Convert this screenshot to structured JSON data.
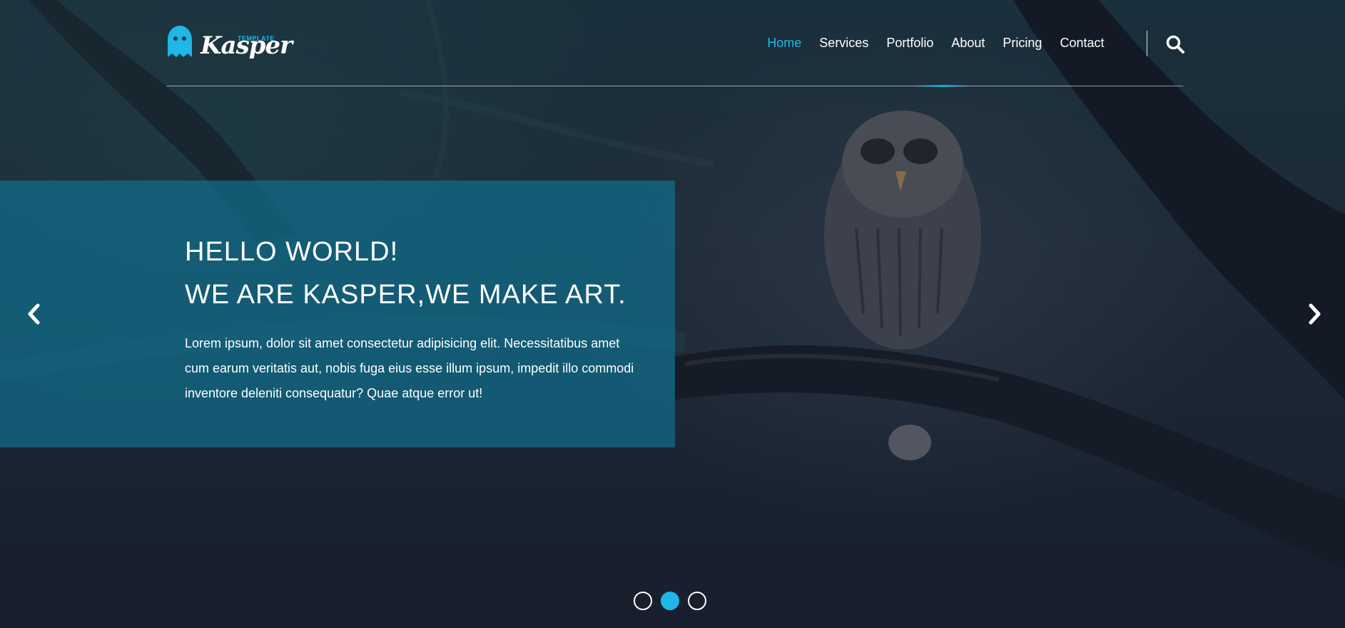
{
  "brand": {
    "name": "Kasper",
    "tagline": "TEMPLATE",
    "accent_color": "#1fb6e8"
  },
  "nav": {
    "items": [
      {
        "label": "Home",
        "active": true
      },
      {
        "label": "Services",
        "active": false
      },
      {
        "label": "Portfolio",
        "active": false
      },
      {
        "label": "About",
        "active": false
      },
      {
        "label": "Pricing",
        "active": false
      },
      {
        "label": "Contact",
        "active": false
      }
    ],
    "search_icon": "search-icon"
  },
  "hero": {
    "headline_line1": "HELLO WORLD!",
    "headline_line2": "WE ARE KASPER,WE MAKE ART.",
    "body": "Lorem ipsum, dolor sit amet consectetur adipisicing elit. Necessitatibus amet cum earum veritatis aut, nobis fuga eius esse illum ipsum, impedit illo commodi inventore deleniti consequatur? Quae atque error ut!",
    "box_color": "#116e8c"
  },
  "slider": {
    "prev_icon": "chevron-left-icon",
    "next_icon": "chevron-right-icon",
    "bullet_count": 3,
    "active_index": 1
  }
}
